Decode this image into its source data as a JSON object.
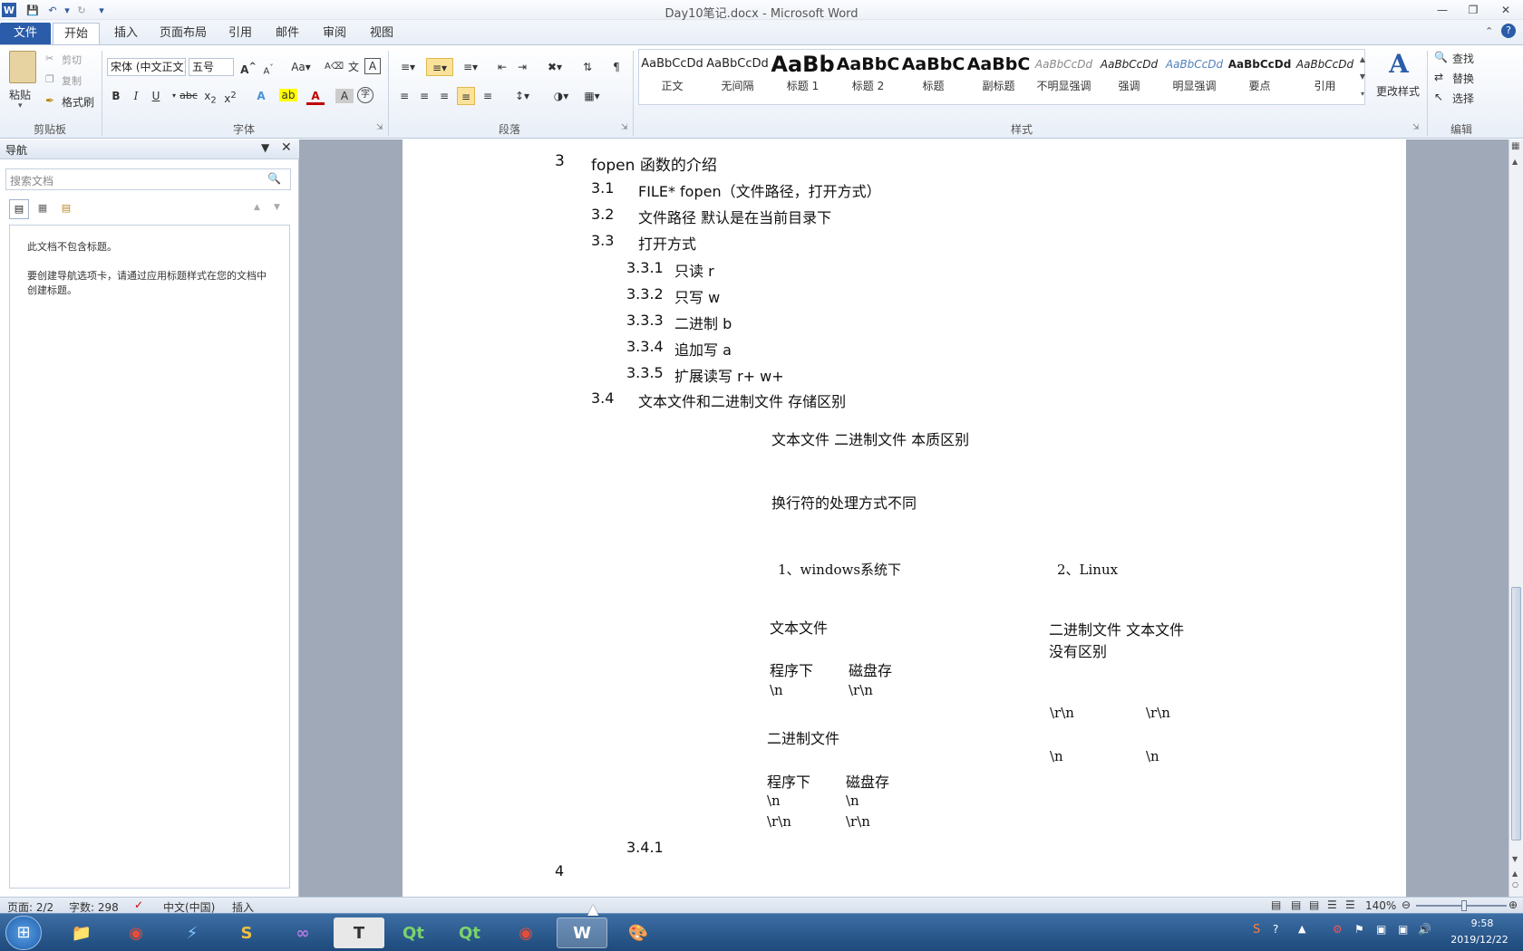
{
  "window": {
    "title": "Day10笔记.docx - Microsoft Word"
  },
  "tabs": [
    "文件",
    "开始",
    "插入",
    "页面布局",
    "引用",
    "邮件",
    "审阅",
    "视图"
  ],
  "ribbon": {
    "clipboard": {
      "paste": "粘贴",
      "cut": "剪切",
      "copy": "复制",
      "format_painter": "格式刷",
      "label": "剪贴板"
    },
    "font": {
      "name": "宋体 (中文正文)",
      "size": "五号",
      "label": "字体"
    },
    "paragraph": {
      "label": "段落"
    },
    "styles": {
      "label": "样式",
      "items": [
        {
          "preview": "AaBbCcDd",
          "name": "正文"
        },
        {
          "preview": "AaBbCcDd",
          "name": "无间隔"
        },
        {
          "preview": "AaBb",
          "name": "标题 1"
        },
        {
          "preview": "AaBbC",
          "name": "标题 2"
        },
        {
          "preview": "AaBbC",
          "name": "标题"
        },
        {
          "preview": "AaBbC",
          "name": "副标题"
        },
        {
          "preview": "AaBbCcDd",
          "name": "不明显强调"
        },
        {
          "preview": "AaBbCcDd",
          "name": "强调"
        },
        {
          "preview": "AaBbCcDd",
          "name": "明显强调"
        },
        {
          "preview": "AaBbCcDd",
          "name": "要点"
        },
        {
          "preview": "AaBbCcDd",
          "name": "引用"
        }
      ],
      "change_styles": "更改样式"
    },
    "editing": {
      "find": "查找",
      "replace": "替换",
      "select": "选择",
      "label": "编辑"
    }
  },
  "nav": {
    "title": "导航",
    "search_placeholder": "搜索文档",
    "msg1": "此文档不包含标题。",
    "msg2": "要创建导航选项卡，请通过应用标题样式在您的文档中创建标题。"
  },
  "doc": {
    "h3": {
      "num": "3",
      "text": "fopen 函数的介绍"
    },
    "h31": {
      "num": "3.1",
      "text": "FILE*    fopen（文件路径，打开方式）"
    },
    "h32": {
      "num": "3.2",
      "text": "文件路径  默认是在当前目录下"
    },
    "h33": {
      "num": "3.3",
      "text": "打开方式"
    },
    "h331": {
      "num": "3.3.1",
      "text": "只读      r"
    },
    "h332": {
      "num": "3.3.2",
      "text": "只写      w"
    },
    "h333": {
      "num": "3.3.3",
      "text": "二进制    b"
    },
    "h334": {
      "num": "3.3.4",
      "text": "追加写    a"
    },
    "h335": {
      "num": "3.3.5",
      "text": "扩展读写  r+      w+"
    },
    "h34": {
      "num": "3.4",
      "text": "文本文件和二进制文件  存储区别"
    },
    "diff_title": "文本文件    二进制文件  本质区别",
    "newline": "换行符的处理方式不同",
    "windows": "1、windows系统下",
    "linux": "2、Linux",
    "text_file": "文本文件",
    "prog": "程序下",
    "disk": "磁盘存",
    "nl": "\\n",
    "rn": "\\r\\n",
    "binary_file": "二进制文件",
    "prog2": "程序下",
    "disk2": "磁盘存",
    "b_nl1": "\\n",
    "b_nl2": "\\n",
    "b_rn1": "\\r\\n",
    "b_rn2": "\\r\\n",
    "linux_header": "二进制文件    文本文件",
    "no_diff": "没有区别",
    "l_rn1": "\\r\\n",
    "l_rn2": "\\r\\n",
    "l_n1": "\\n",
    "l_n2": "\\n",
    "h341": "3.4.1",
    "h4": "4"
  },
  "status": {
    "page": "页面: 2/2",
    "words": "字数: 298",
    "lang": "中文(中国)",
    "mode": "插入",
    "zoom": "140%"
  },
  "clock": {
    "time": "9:58",
    "date": "2019/12/22"
  },
  "accent": "#2a5ca9"
}
